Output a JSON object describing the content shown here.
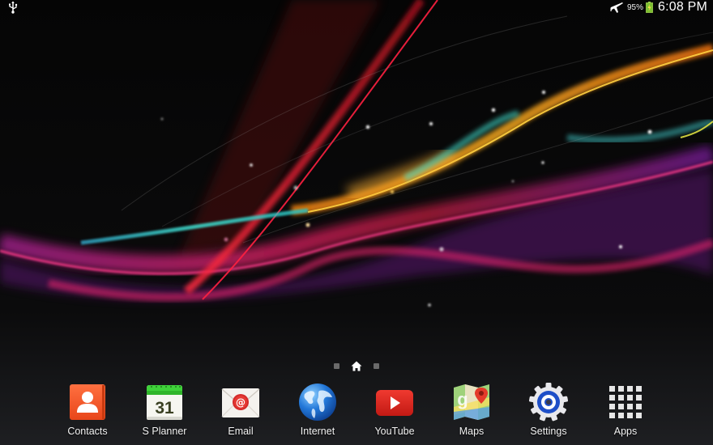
{
  "status_bar": {
    "left_icons": [
      "usb-icon"
    ],
    "right_icons": [
      "airplane-mode-icon",
      "battery-charging-icon"
    ],
    "battery_percent": "95%",
    "time": "6:08 PM"
  },
  "home": {
    "page_indicator": {
      "pages": [
        "dot",
        "home",
        "dot"
      ],
      "current_index": 1
    }
  },
  "dock": {
    "apps": [
      {
        "label": "Contacts",
        "icon": "contacts-icon",
        "color": "#f05a22"
      },
      {
        "label": "S Planner",
        "icon": "calendar-icon",
        "date": "31",
        "color": "#3cc63c"
      },
      {
        "label": "Email",
        "icon": "email-icon",
        "symbol": "@",
        "color": "#d3232a"
      },
      {
        "label": "Internet",
        "icon": "globe-icon",
        "color": "#1f6fd0"
      },
      {
        "label": "YouTube",
        "icon": "youtube-icon",
        "color": "#e02a20"
      },
      {
        "label": "Maps",
        "icon": "maps-icon",
        "color": "#4caf50"
      },
      {
        "label": "Settings",
        "icon": "settings-gear-icon",
        "color": "#1e4fc8"
      },
      {
        "label": "Apps",
        "icon": "apps-grid-icon",
        "color": "#e8e8e8"
      }
    ]
  }
}
